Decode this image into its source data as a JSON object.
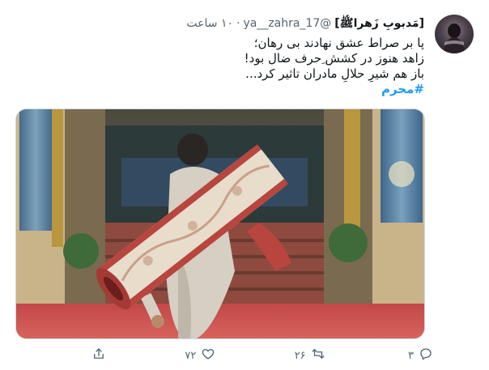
{
  "author": {
    "display_name": "[مَدبوبِ زَهراﷺ]",
    "handle": "@ya__zahra_17",
    "separator": "·",
    "time": "۱۰ ساعت"
  },
  "tweet": {
    "lines": [
      "پا بر صراط عشق نهادند بی رهان؛",
      "زاهد هنوز در کشش ِحرف ضال بود!",
      "باز هم شیرِ حلالِ مادران تاثیر کرد..."
    ],
    "hashtag": "#محرم"
  },
  "actions": {
    "reply_count": "۳",
    "retweet_count": "۲۶",
    "like_count": "۷۲",
    "share_count": ""
  },
  "colors": {
    "link": "#1d9bf0",
    "muted": "#536471",
    "text": "#0f1419"
  },
  "icons": [
    "reply-icon",
    "retweet-icon",
    "like-icon",
    "share-icon"
  ]
}
